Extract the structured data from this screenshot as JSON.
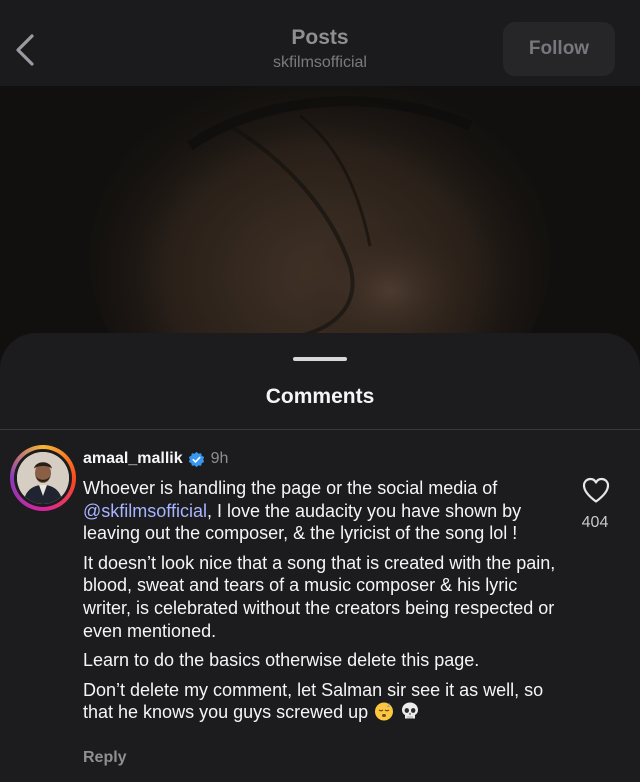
{
  "header": {
    "title": "Posts",
    "subtitle": "skfilmsofficial",
    "follow_label": "Follow"
  },
  "sheet": {
    "title": "Comments"
  },
  "comment": {
    "username": "amaal_mallik",
    "time": "9h",
    "mention": "@skfilmsofficial",
    "p1_before": "Whoever is handling the page or the social media of ",
    "p1_after": ", I love the audacity you have shown by leaving out the composer, & the lyricist of the song lol !",
    "p2": "It doesn’t look nice that a song that is created with the pain, blood, sweat and tears of a music composer & his lyric writer, is celebrated without the creators being respected or even mentioned.",
    "p3": "Learn to do the basics otherwise delete this page.",
    "p4": "Don’t delete my comment, let Salman sir see it as well, so that he knows you guys screwed up",
    "reply_label": "Reply",
    "like_count": "404"
  },
  "icons": {
    "back": "chevron-left-icon",
    "verified": "verified-badge-icon",
    "like": "heart-icon",
    "emoji_1": "sleepy-face-emoji",
    "emoji_2": "skull-emoji"
  },
  "colors": {
    "background": "#1c1c1e",
    "mention": "#a7b4ff",
    "verified": "#3897f0",
    "muted": "#8e8e93"
  }
}
